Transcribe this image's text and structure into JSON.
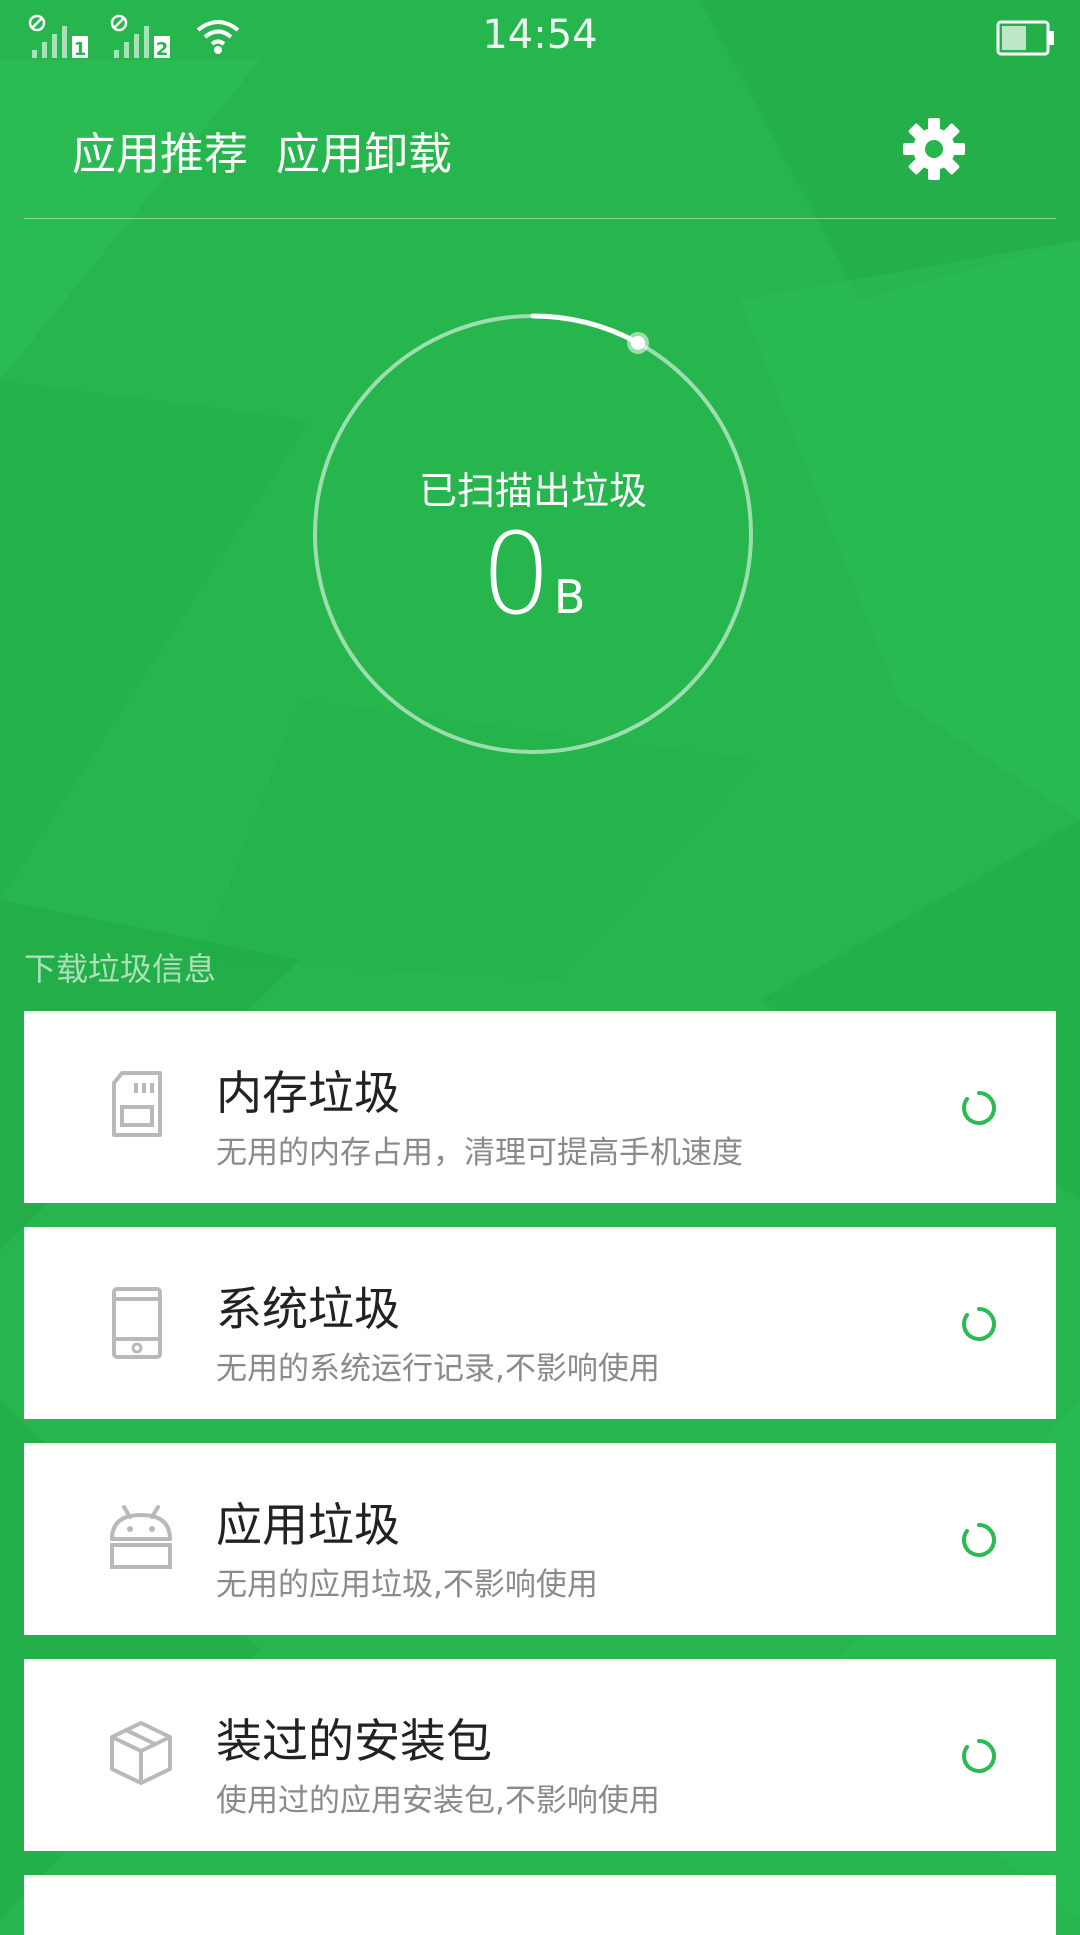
{
  "status_bar": {
    "time": "14:54",
    "sim1_label": "1",
    "sim2_label": "2"
  },
  "header": {
    "tabs": [
      {
        "label": "应用推荐"
      },
      {
        "label": "应用卸载"
      }
    ],
    "settings_icon": "gear-icon"
  },
  "scan": {
    "label": "已扫描出垃圾",
    "value": "0",
    "unit": "B",
    "progress_fraction": 0.08
  },
  "section": {
    "title": "下载垃圾信息"
  },
  "items": [
    {
      "icon": "sd-card-icon",
      "title": "内存垃圾",
      "desc": "无用的内存占用，清理可提高手机速度"
    },
    {
      "icon": "phone-icon",
      "title": "系统垃圾",
      "desc": "无用的系统运行记录,不影响使用"
    },
    {
      "icon": "android-icon",
      "title": "应用垃圾",
      "desc": "无用的应用垃圾,不影响使用"
    },
    {
      "icon": "package-box-icon",
      "title": "装过的安装包",
      "desc": "使用过的应用安装包,不影响使用"
    }
  ],
  "colors": {
    "background": "#27b64e",
    "accent": "#2cbb52",
    "card": "#ffffff"
  }
}
